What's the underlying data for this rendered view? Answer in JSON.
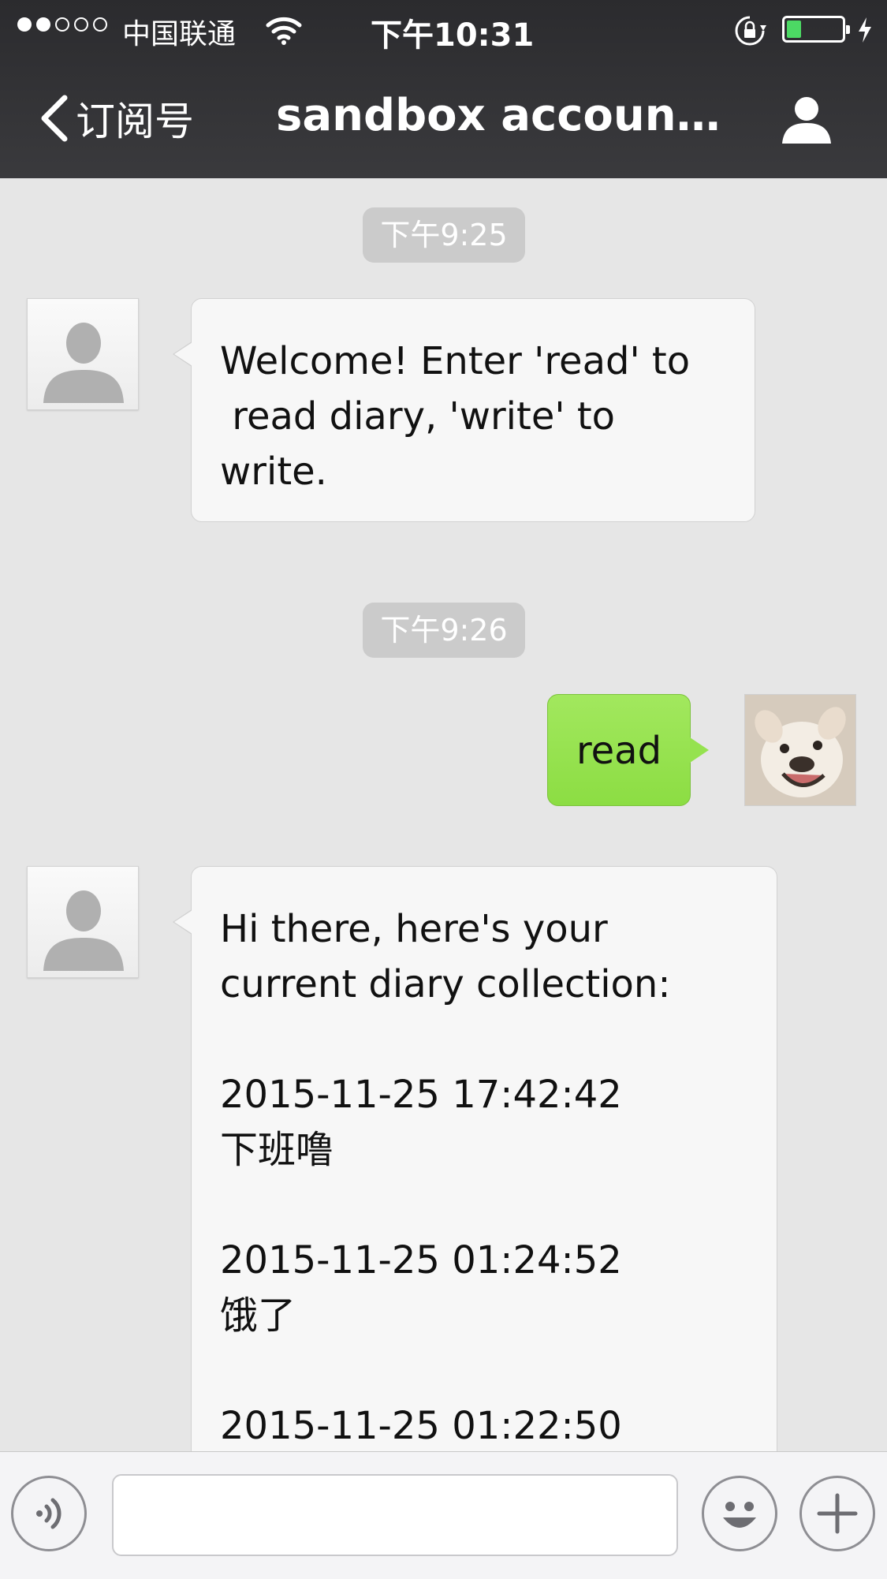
{
  "status_bar": {
    "carrier": "中国联通",
    "time": "下午10:31",
    "signal_strength": 2,
    "signal_max": 5,
    "battery_level": 0.2,
    "battery_color": "#4cd964"
  },
  "nav": {
    "back_label": "订阅号",
    "title": "sandbox account…",
    "back_icon": "chevron-left-icon",
    "profile_icon": "person-icon"
  },
  "messages": [
    {
      "type": "timestamp",
      "text": "下午9:25"
    },
    {
      "type": "incoming",
      "text": "Welcome! Enter 'read' to\n read diary, 'write' to\nwrite."
    },
    {
      "type": "timestamp",
      "text": "下午9:26"
    },
    {
      "type": "outgoing",
      "text": "read"
    },
    {
      "type": "incoming",
      "text": "Hi there, here's your\ncurrent diary collection:\n\n2015-11-25 17:42:42\n下班噜\n\n2015-11-25 01:24:52\n饿了\n\n2015-11-25 01:22:50"
    }
  ],
  "input_bar": {
    "placeholder": "",
    "voice_icon": "voice-icon",
    "emoji_icon": "emoji-icon",
    "plus_icon": "plus-icon"
  },
  "colors": {
    "nav_bg": "#2f2f32",
    "chat_bg": "#e6e6e6",
    "outgoing_bubble": "#95e24f",
    "incoming_bubble": "#f7f7f7"
  }
}
